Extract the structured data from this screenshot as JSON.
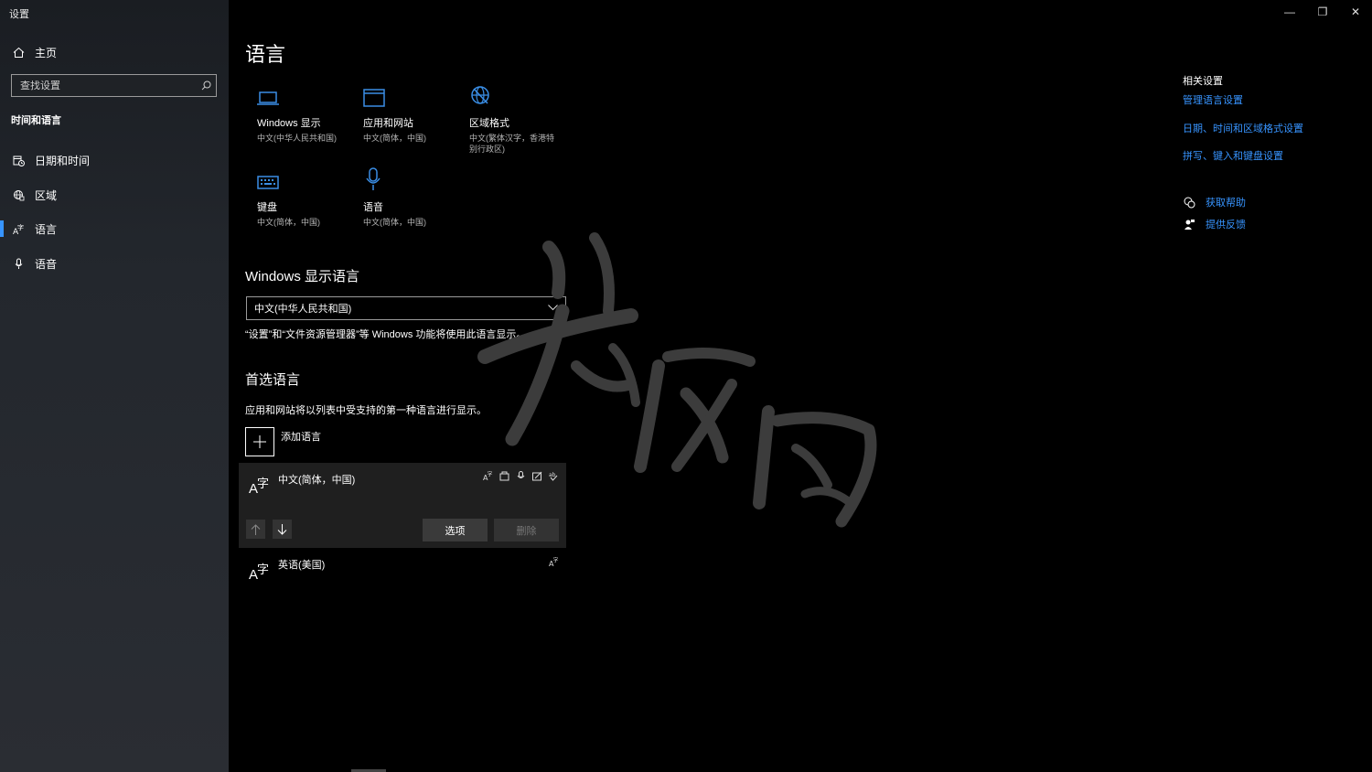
{
  "window": {
    "title": "设置",
    "minimize": "—",
    "maximize": "❐",
    "close": "✕"
  },
  "sidebar": {
    "home_label": "主页",
    "search_placeholder": "查找设置",
    "section_title": "时间和语言",
    "items": [
      {
        "label": "日期和时间",
        "icon": "calendar-clock-icon"
      },
      {
        "label": "区域",
        "icon": "globe-region-icon"
      },
      {
        "label": "语言",
        "icon": "language-icon",
        "active": true
      },
      {
        "label": "语音",
        "icon": "microphone-icon"
      }
    ]
  },
  "main": {
    "title": "语言",
    "tiles": [
      {
        "name": "Windows 显示",
        "sub": "中文(中华人民共和国)",
        "icon": "laptop-icon"
      },
      {
        "name": "应用和网站",
        "sub": "中文(简体，中国)",
        "icon": "browser-window-icon"
      },
      {
        "name": "区域格式",
        "sub": "中文(繁体汉字，香港特别行政区)",
        "icon": "region-globe-icon"
      },
      {
        "name": "键盘",
        "sub": "中文(简体，中国)",
        "icon": "keyboard-icon"
      },
      {
        "name": "语音",
        "sub": "中文(简体，中国)",
        "icon": "microphone-icon"
      }
    ],
    "display_language": {
      "heading": "Windows 显示语言",
      "selected": "中文(中华人民共和国)",
      "description": "“设置”和“文件资源管理器”等 Windows 功能将使用此语言显示。"
    },
    "preferred": {
      "heading": "首选语言",
      "description": "应用和网站将以列表中受支持的第一种语言进行显示。",
      "add_label": "添加语言",
      "languages": [
        {
          "name": "中文(简体，中国)",
          "features": [
            "display-language-icon",
            "text-to-speech-icon",
            "speech-recognition-icon",
            "handwriting-icon",
            "spelling-icon"
          ]
        },
        {
          "name": "英语(美国)",
          "features": [
            "display-language-icon"
          ]
        }
      ],
      "options_label": "选项",
      "remove_label": "删除"
    }
  },
  "related": {
    "title": "相关设置",
    "links": [
      "管理语言设置",
      "日期、时间和区域格式设置",
      "拼写、键入和键盘设置"
    ],
    "help": "获取帮助",
    "feedback": "提供反馈"
  },
  "colors": {
    "accent": "#3794ff",
    "tile_icon": "#3a8ee6"
  }
}
